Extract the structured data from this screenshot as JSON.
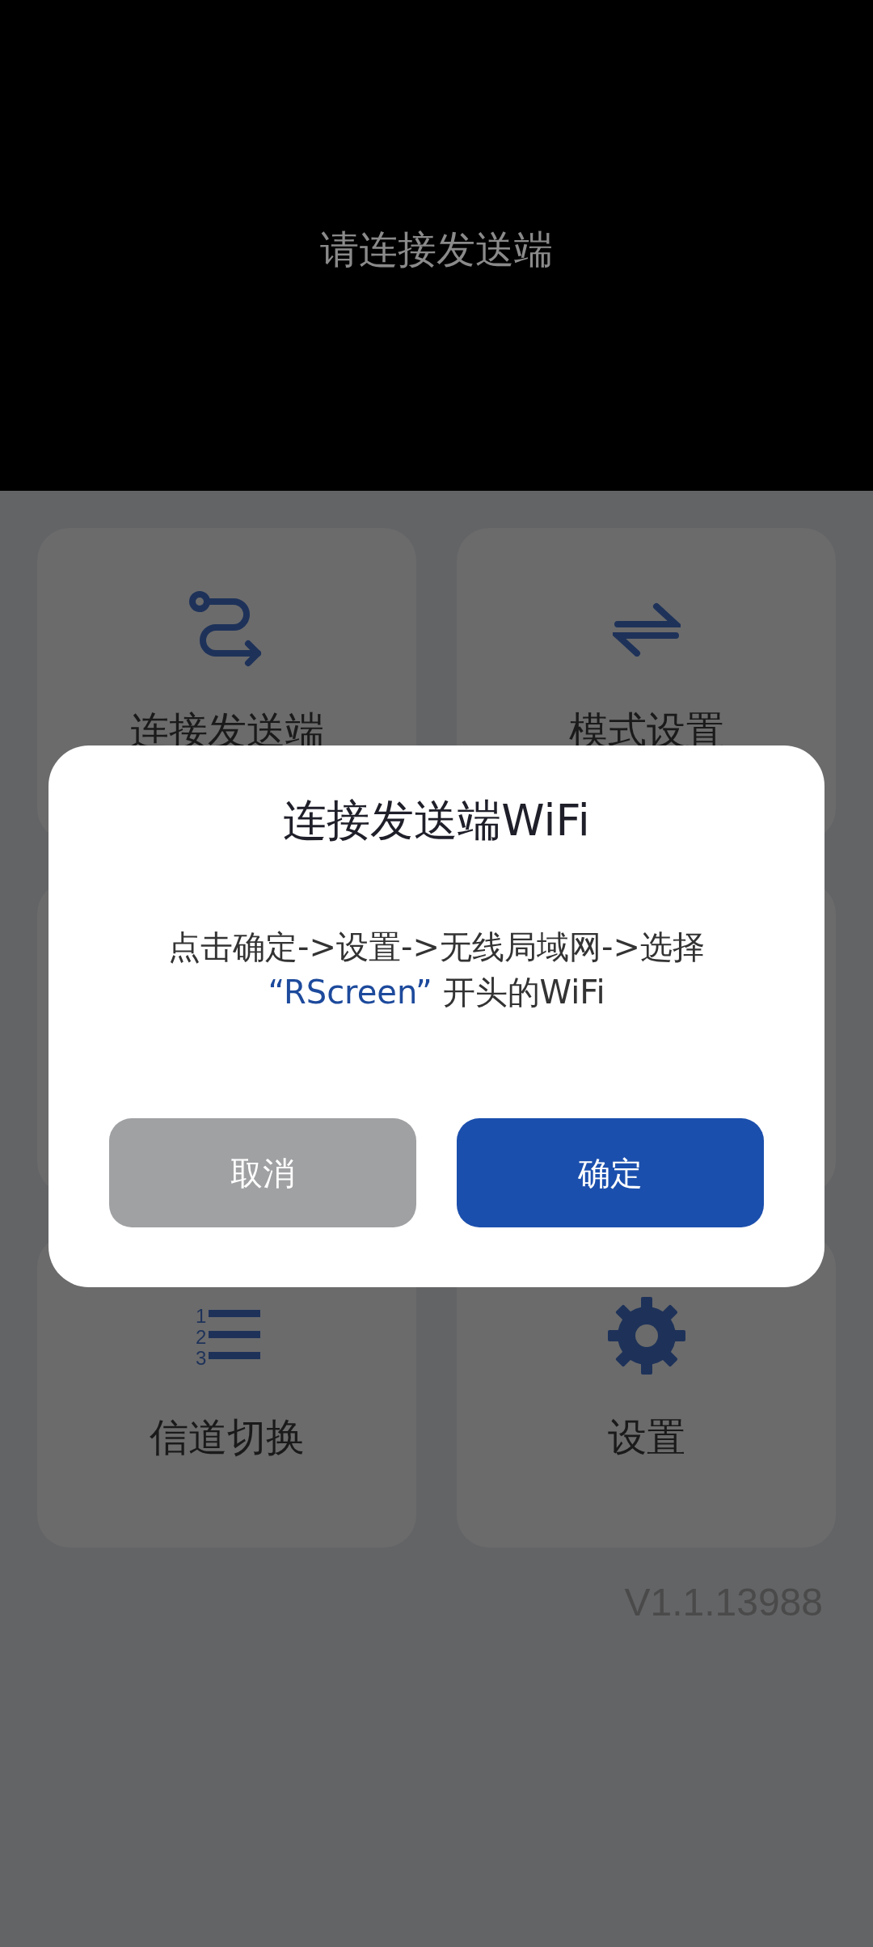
{
  "header": {
    "status_text": "请连接发送端"
  },
  "cards": [
    {
      "kind": "route",
      "label": "连接发送端"
    },
    {
      "kind": "swap",
      "label": "模式设置"
    },
    {
      "kind": "hidden"
    },
    {
      "kind": "hidden"
    },
    {
      "kind": "numbered-list",
      "label": "信道切换",
      "icon_numbers": [
        "1",
        "2",
        "3"
      ]
    },
    {
      "kind": "gear",
      "label": "设置"
    }
  ],
  "version": "V1.1.13988",
  "dialog": {
    "title": "连接发送端WiFi",
    "message_lines": [
      [
        {
          "kind": "plain",
          "text": "点击确定->设置->无线局域网->选择"
        }
      ],
      [
        {
          "kind": "highlight",
          "text": "“RScreen”"
        },
        {
          "kind": "plain",
          "text": " 开头的WiFi"
        }
      ]
    ],
    "buttons": [
      {
        "kind": "cancel",
        "label": "取消"
      },
      {
        "kind": "confirm",
        "label": "确定"
      }
    ]
  }
}
